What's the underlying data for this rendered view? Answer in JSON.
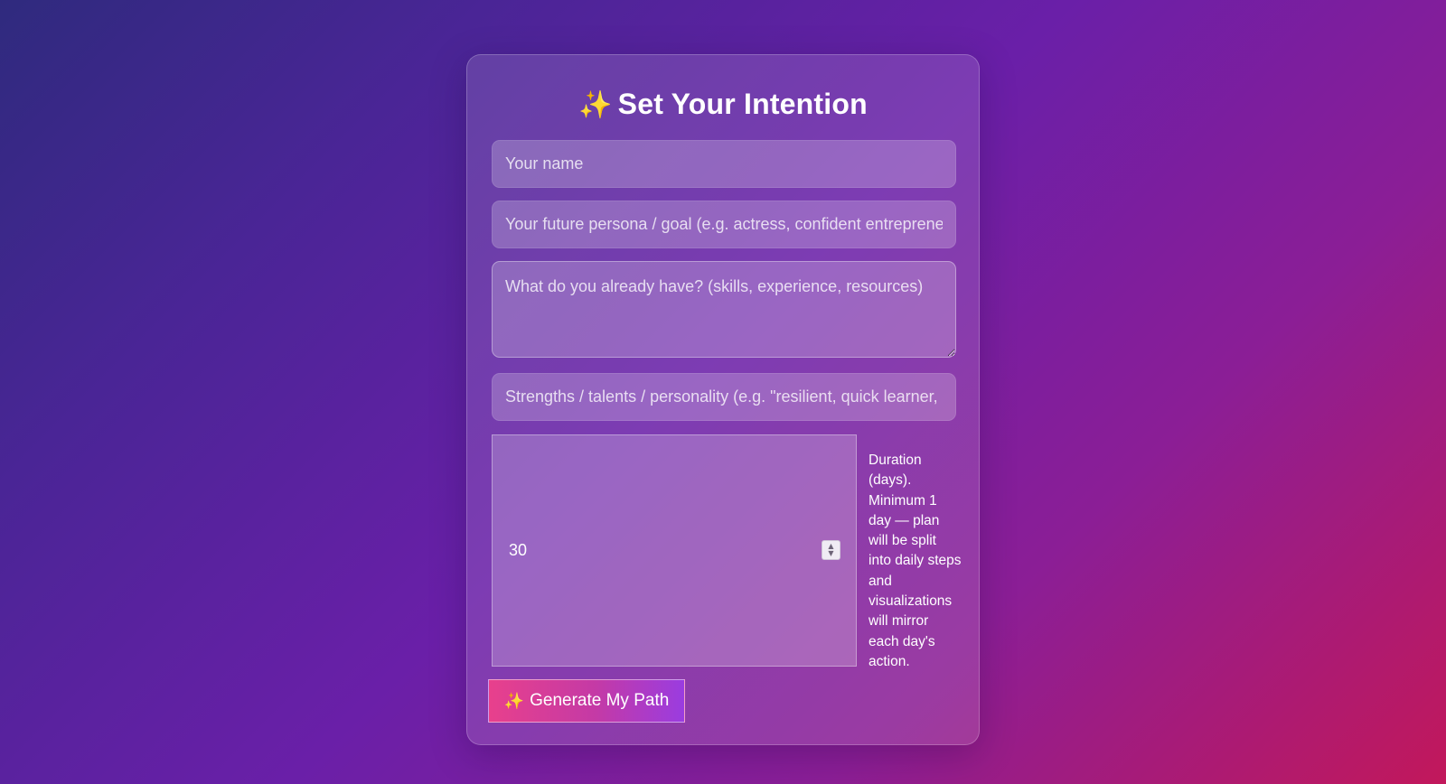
{
  "form": {
    "title": "Set Your Intention",
    "title_icon": "✨",
    "name_placeholder": "Your name",
    "persona_placeholder": "Your future persona / goal (e.g. actress, confident entrepreneur)",
    "have_placeholder": "What do you already have? (skills, experience, resources)",
    "strengths_placeholder": "Strengths / talents / personality (e.g. \"resilient, quick learner, empathetic\")",
    "duration_value": "30",
    "duration_hint": "Duration (days). Minimum 1 day — plan will be split into daily steps and visualizations will mirror each day's action.",
    "generate_icon": "✨",
    "generate_label": "Generate My Path"
  },
  "icons": {
    "title": "sparkles-icon",
    "spinner_up": "chevron-up-icon",
    "spinner_down": "chevron-down-icon",
    "button": "sparkles-icon"
  },
  "colors": {
    "background_start": "#2f2a7e",
    "background_end": "#c2185b",
    "button_start": "#e8408c",
    "button_end": "#9a3ce0",
    "sparkle": "#f5b73a"
  }
}
